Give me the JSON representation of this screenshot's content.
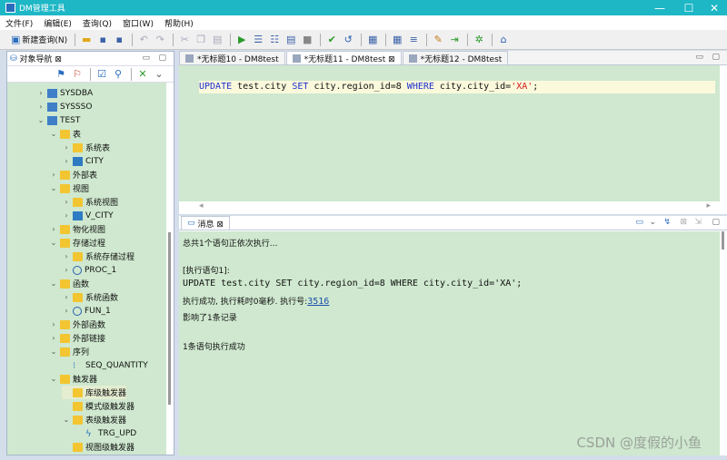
{
  "window": {
    "title": "DM管理工具",
    "minimize": "—",
    "maximize": "☐",
    "close": "✕"
  },
  "menu": [
    "文件(F)",
    "编辑(E)",
    "查询(Q)",
    "窗口(W)",
    "帮助(H)"
  ],
  "toolbar": {
    "new_query": "新建查询(N)"
  },
  "nav": {
    "title": "对象导航 ⊠",
    "tree": [
      {
        "label": "SYSDBA",
        "indent": 1,
        "arrow": "›",
        "icon": "db"
      },
      {
        "label": "SYSSSO",
        "indent": 1,
        "arrow": "›",
        "icon": "db"
      },
      {
        "label": "TEST",
        "indent": 1,
        "arrow": "⌄",
        "icon": "db"
      },
      {
        "label": "表",
        "indent": 2,
        "arrow": "⌄",
        "icon": "folder"
      },
      {
        "label": "系统表",
        "indent": 3,
        "arrow": "›",
        "icon": "folder"
      },
      {
        "label": "CITY",
        "indent": 3,
        "arrow": "›",
        "icon": "table"
      },
      {
        "label": "外部表",
        "indent": 2,
        "arrow": "›",
        "icon": "folder"
      },
      {
        "label": "视图",
        "indent": 2,
        "arrow": "⌄",
        "icon": "folder"
      },
      {
        "label": "系统视图",
        "indent": 3,
        "arrow": "›",
        "icon": "folder"
      },
      {
        "label": "V_CITY",
        "indent": 3,
        "arrow": "›",
        "icon": "table"
      },
      {
        "label": "物化视图",
        "indent": 2,
        "arrow": "›",
        "icon": "folder"
      },
      {
        "label": "存储过程",
        "indent": 2,
        "arrow": "⌄",
        "icon": "folder"
      },
      {
        "label": "系统存储过程",
        "indent": 3,
        "arrow": "›",
        "icon": "folder"
      },
      {
        "label": "PROC_1",
        "indent": 3,
        "arrow": "›",
        "icon": "circle"
      },
      {
        "label": "函数",
        "indent": 2,
        "arrow": "⌄",
        "icon": "folder"
      },
      {
        "label": "系统函数",
        "indent": 3,
        "arrow": "›",
        "icon": "folder"
      },
      {
        "label": "FUN_1",
        "indent": 3,
        "arrow": "›",
        "icon": "circle"
      },
      {
        "label": "外部函数",
        "indent": 2,
        "arrow": "›",
        "icon": "folder"
      },
      {
        "label": "外部链接",
        "indent": 2,
        "arrow": "›",
        "icon": "folder"
      },
      {
        "label": "序列",
        "indent": 2,
        "arrow": "⌄",
        "icon": "folder"
      },
      {
        "label": "SEQ_QUANTITY",
        "indent": 3,
        "arrow": "",
        "icon": "seq"
      },
      {
        "label": "触发器",
        "indent": 2,
        "arrow": "⌄",
        "icon": "folder"
      },
      {
        "label": "库级触发器",
        "indent": 3,
        "arrow": "",
        "icon": "folder",
        "selected": true
      },
      {
        "label": "模式级触发器",
        "indent": 3,
        "arrow": "",
        "icon": "folder"
      },
      {
        "label": "表级触发器",
        "indent": 3,
        "arrow": "⌄",
        "icon": "folder"
      },
      {
        "label": "TRG_UPD",
        "indent": 4,
        "arrow": "",
        "icon": "trigger"
      },
      {
        "label": "视图级触发器",
        "indent": 3,
        "arrow": "",
        "icon": "folder"
      }
    ]
  },
  "editor": {
    "tabs": [
      {
        "label": "*无标题10 - DM8test"
      },
      {
        "label": "*无标题11 - DM8test ⊠",
        "active": true
      },
      {
        "label": "*无标题12 - DM8test"
      }
    ],
    "sql": {
      "kw1": "UPDATE",
      "t1": " test.city ",
      "kw2": "SET",
      "t2": " city.region_id=8 ",
      "kw3": "WHERE",
      "t3": " city.city_id=",
      "str": "'XA'",
      "t4": ";"
    }
  },
  "messages": {
    "tab": "消息 ⊠",
    "lines": {
      "summary": "总共1个语句正依次执行...",
      "exec_label": "[执行语句1]:",
      "sql": "UPDATE test.city SET city.region_id=8 WHERE city.city_id='XA';",
      "success_prefix": "执行成功, 执行耗时0毫秒. 执行号:",
      "exec_no": "3516",
      "affected": "影响了1条记录",
      "done": "1条语句执行成功"
    },
    "watermark": "CSDN @度假的小鱼"
  }
}
